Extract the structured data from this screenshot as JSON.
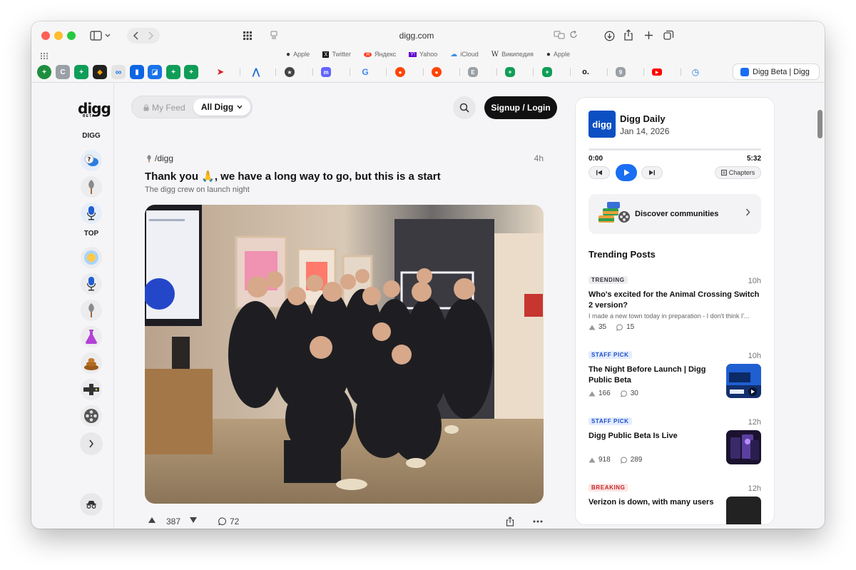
{
  "browser": {
    "url": "digg.com",
    "favorites": [
      {
        "label": "Apple",
        "icon": "apple-icon",
        "glyph": ""
      },
      {
        "label": "Twitter",
        "icon": "x-icon",
        "glyph": "X"
      },
      {
        "label": "Яндекс",
        "icon": "yandex-icon",
        "glyph": "Я"
      },
      {
        "label": "Yahoo",
        "icon": "yahoo-icon",
        "glyph": "Y!"
      },
      {
        "label": "iCloud",
        "icon": "icloud-icon",
        "glyph": "☁"
      },
      {
        "label": "Википедия",
        "icon": "wikipedia-icon",
        "glyph": "W"
      },
      {
        "label": "Apple",
        "icon": "apple-icon",
        "glyph": ""
      }
    ],
    "active_tab": "Digg Beta | Digg"
  },
  "nav": {
    "logo": "digg",
    "logo_beta": "BETA",
    "section_digg": "DIGG",
    "section_top": "TOP"
  },
  "header": {
    "my_feed": "My Feed",
    "all_digg": "All Digg",
    "login": "Signup / Login"
  },
  "post": {
    "community": "/digg",
    "time": "4h",
    "title": "Thank you 🙏, we have a long way to go, but this is a start",
    "subtitle": "The digg crew on launch night",
    "upvotes": "387",
    "comments": "72"
  },
  "sidebar": {
    "podcast_art": "digg",
    "podcast_title": "Digg Daily",
    "podcast_date": "Jan 14, 2026",
    "time_start": "0:00",
    "time_end": "5:32",
    "chapters": "Chapters",
    "discover": "Discover communities",
    "trending_heading": "Trending Posts",
    "items": [
      {
        "badge": "TRENDING",
        "time": "10h",
        "title_line1": "Who's excited for the Animal Crossing Switch",
        "title_line2": "2 version?",
        "excerpt": "I made a new town today in preparation - I don't think I'...",
        "up": "35",
        "comments": "15"
      },
      {
        "badge": "STAFF PICK",
        "time": "10h",
        "title_line1": "The Night Before Launch | Digg",
        "title_line2": "Public Beta",
        "up": "166",
        "comments": "30"
      },
      {
        "badge": "STAFF PICK",
        "time": "12h",
        "title_line1": "Digg Public Beta Is Live",
        "up": "918",
        "comments": "289"
      },
      {
        "badge": "BREAKING",
        "time": "12h",
        "title_line1": "Verizon is down, with many users"
      }
    ]
  },
  "colors": {
    "accent": "#1a6ef2",
    "login_bg": "#111111"
  }
}
